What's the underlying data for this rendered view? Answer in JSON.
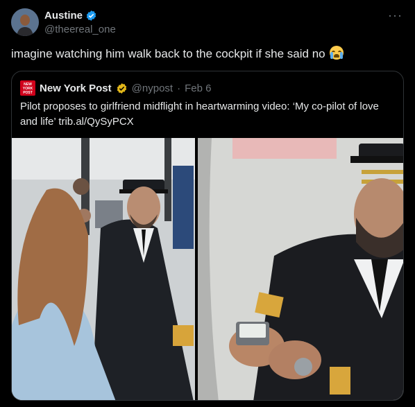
{
  "tweet": {
    "author_name": "Austine",
    "author_handle": "@theereal_one",
    "more_label": "···",
    "text": "imagine watching him walk back to the cockpit if she said no",
    "emoji": "loudly-crying-face"
  },
  "quote": {
    "logo_text": "NEW YORK POST",
    "author_name": "New York Post",
    "author_handle": "@nypost",
    "separator": "·",
    "date": "Feb 6",
    "text": "Pilot proposes to girlfriend midflight in heartwarming video: ‘My co-pilot of love and life’ trib.al/QySyPCX"
  },
  "colors": {
    "background": "#000000",
    "text": "#e7e9ea",
    "secondary": "#71767b",
    "verified_blue": "#1d9bf0",
    "verified_gold": "#e2b719",
    "nypost_red": "#d0021b",
    "border": "#2f3336"
  }
}
